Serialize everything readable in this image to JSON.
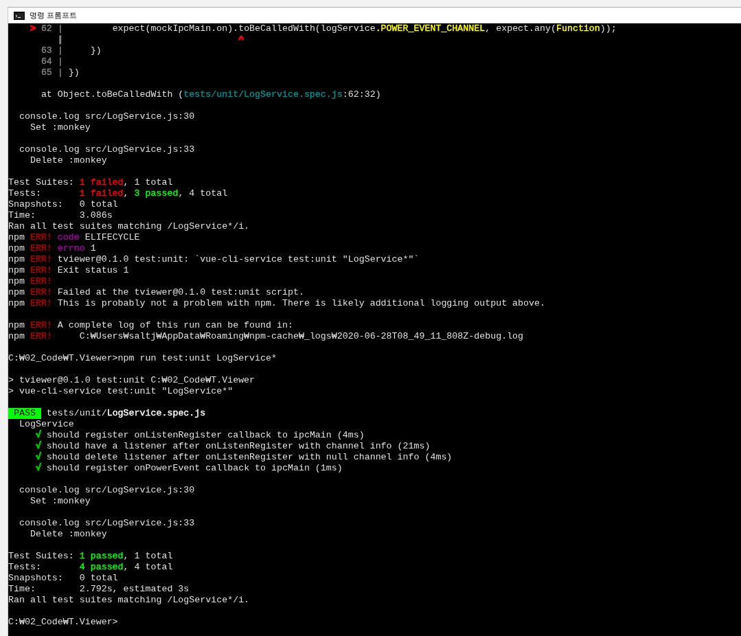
{
  "window": {
    "title": "명령 프롬프트"
  },
  "lines": [
    {
      "kind": "text",
      "segments": [
        {
          "text": "    >",
          "color": "#ff0000"
        },
        {
          "text": " 62 |",
          "color": "#808080"
        },
        {
          "text": "         expect(mockIpcMain.on).toBeCalledWith(logService"
        },
        {
          "text": ".POWER_EVENT_CHANNEL",
          "color": "#ffff00"
        },
        {
          "text": ", expect.any("
        },
        {
          "text": "Function",
          "color": "#ffff00"
        },
        {
          "text": "));"
        }
      ]
    },
    {
      "kind": "text",
      "segments": [
        {
          "text": "         |",
          "color": "#808080"
        },
        {
          "text": "                                ^",
          "color": "#ff0000"
        }
      ]
    },
    {
      "kind": "text",
      "segments": [
        {
          "text": "      63 |",
          "color": "#808080"
        },
        {
          "text": "     })"
        }
      ]
    },
    {
      "kind": "text",
      "segments": [
        {
          "text": "      64 |",
          "color": "#808080"
        }
      ]
    },
    {
      "kind": "text",
      "segments": [
        {
          "text": "      65 |",
          "color": "#808080"
        },
        {
          "text": " })"
        }
      ]
    },
    {
      "kind": "blank"
    },
    {
      "kind": "text",
      "segments": [
        {
          "text": "      at Object.toBeCalledWith ("
        },
        {
          "text": "tests/unit/LogService.spec.js",
          "color": "#008b8b"
        },
        {
          "text": ":62:32)"
        }
      ]
    },
    {
      "kind": "blank"
    },
    {
      "kind": "text",
      "segments": [
        {
          "text": "  console.log src/LogService.js:30"
        }
      ]
    },
    {
      "kind": "text",
      "segments": [
        {
          "text": "    Set :monkey"
        }
      ]
    },
    {
      "kind": "blank"
    },
    {
      "kind": "text",
      "segments": [
        {
          "text": "  console.log src/LogService.js:33"
        }
      ]
    },
    {
      "kind": "text",
      "segments": [
        {
          "text": "    Delete :monkey"
        }
      ]
    },
    {
      "kind": "blank"
    },
    {
      "kind": "text",
      "segments": [
        {
          "text": "Test Suites: "
        },
        {
          "text": "1 failed",
          "color": "#ff0000"
        },
        {
          "text": ", 1 total"
        }
      ]
    },
    {
      "kind": "text",
      "segments": [
        {
          "text": "Tests:       "
        },
        {
          "text": "1 failed",
          "color": "#ff0000"
        },
        {
          "text": ", "
        },
        {
          "text": "3 passed",
          "color": "#00ff00"
        },
        {
          "text": ", 4 total"
        }
      ]
    },
    {
      "kind": "text",
      "segments": [
        {
          "text": "Snapshots:   0 total"
        }
      ]
    },
    {
      "kind": "text",
      "segments": [
        {
          "text": "Time:        3.086s"
        }
      ]
    },
    {
      "kind": "text",
      "segments": [
        {
          "text": "Ran all test suites matching /LogService*/i."
        }
      ]
    },
    {
      "kind": "text",
      "segments": [
        {
          "text": "npm "
        },
        {
          "text": "ERR!",
          "color": "#b00000"
        },
        {
          "text": " code",
          "color": "#a000a0"
        },
        {
          "text": " ELIFECYCLE"
        }
      ]
    },
    {
      "kind": "text",
      "segments": [
        {
          "text": "npm "
        },
        {
          "text": "ERR!",
          "color": "#b00000"
        },
        {
          "text": " errno",
          "color": "#a000a0"
        },
        {
          "text": " 1"
        }
      ]
    },
    {
      "kind": "text",
      "segments": [
        {
          "text": "npm "
        },
        {
          "text": "ERR!",
          "color": "#b00000"
        },
        {
          "text": " tviewer@0.1.0 test:unit: `vue-cli-service test:unit \"LogService*\"`"
        }
      ]
    },
    {
      "kind": "text",
      "segments": [
        {
          "text": "npm "
        },
        {
          "text": "ERR!",
          "color": "#b00000"
        },
        {
          "text": " Exit status 1"
        }
      ]
    },
    {
      "kind": "text",
      "segments": [
        {
          "text": "npm "
        },
        {
          "text": "ERR!",
          "color": "#b00000"
        }
      ]
    },
    {
      "kind": "text",
      "segments": [
        {
          "text": "npm "
        },
        {
          "text": "ERR!",
          "color": "#b00000"
        },
        {
          "text": " Failed at the tviewer@0.1.0 test:unit script."
        }
      ]
    },
    {
      "kind": "text",
      "segments": [
        {
          "text": "npm "
        },
        {
          "text": "ERR!",
          "color": "#b00000"
        },
        {
          "text": " This is probably not a problem with npm. There is likely additional logging output above."
        }
      ]
    },
    {
      "kind": "blank"
    },
    {
      "kind": "text",
      "segments": [
        {
          "text": "npm "
        },
        {
          "text": "ERR!",
          "color": "#b00000"
        },
        {
          "text": " A complete log of this run can be found in:"
        }
      ]
    },
    {
      "kind": "text",
      "segments": [
        {
          "text": "npm "
        },
        {
          "text": "ERR!",
          "color": "#b00000"
        },
        {
          "text": "     C:₩Users₩saltj₩AppData₩Roaming₩npm-cache₩_logs₩2020-06-28T08_49_11_808Z-debug.log"
        }
      ]
    },
    {
      "kind": "blank"
    },
    {
      "kind": "text",
      "segments": [
        {
          "text": "C:₩02_Code₩T.Viewer>npm run test:unit LogService*"
        }
      ]
    },
    {
      "kind": "blank"
    },
    {
      "kind": "text",
      "segments": [
        {
          "text": "> tviewer@0.1.0 test:unit C:₩02_Code₩T.Viewer"
        }
      ]
    },
    {
      "kind": "text",
      "segments": [
        {
          "text": "> vue-cli-service test:unit \"LogService*\""
        }
      ]
    },
    {
      "kind": "blank"
    },
    {
      "kind": "text",
      "segments": [
        {
          "text": " PASS ",
          "color": "#00ff00",
          "kind": "badge"
        },
        {
          "text": " tests/unit/"
        },
        {
          "text": "LogService.spec.js",
          "color": "#ffffff"
        }
      ]
    },
    {
      "kind": "text",
      "segments": [
        {
          "text": "  LogService"
        }
      ]
    },
    {
      "kind": "text",
      "segments": [
        {
          "text": "     √",
          "color": "#00c000"
        },
        {
          "text": " should register onListenRegister callback to ipcMain (4ms)"
        }
      ]
    },
    {
      "kind": "text",
      "segments": [
        {
          "text": "     √",
          "color": "#00c000"
        },
        {
          "text": " should have a listener after onListenRegister with channel info (21ms)"
        }
      ]
    },
    {
      "kind": "text",
      "segments": [
        {
          "text": "     √",
          "color": "#00c000"
        },
        {
          "text": " should delete listener after onListenRegister with null channel info (4ms)"
        }
      ]
    },
    {
      "kind": "text",
      "segments": [
        {
          "text": "     √",
          "color": "#00c000"
        },
        {
          "text": " should register onPowerEvent callback to ipcMain (1ms)"
        }
      ]
    },
    {
      "kind": "blank"
    },
    {
      "kind": "text",
      "segments": [
        {
          "text": "  console.log src/LogService.js:30"
        }
      ]
    },
    {
      "kind": "text",
      "segments": [
        {
          "text": "    Set :monkey"
        }
      ]
    },
    {
      "kind": "blank"
    },
    {
      "kind": "text",
      "segments": [
        {
          "text": "  console.log src/LogService.js:33"
        }
      ]
    },
    {
      "kind": "text",
      "segments": [
        {
          "text": "    Delete :monkey"
        }
      ]
    },
    {
      "kind": "blank"
    },
    {
      "kind": "text",
      "segments": [
        {
          "text": "Test Suites: "
        },
        {
          "text": "1 passed",
          "color": "#00ff00"
        },
        {
          "text": ", 1 total"
        }
      ]
    },
    {
      "kind": "text",
      "segments": [
        {
          "text": "Tests:       "
        },
        {
          "text": "4 passed",
          "color": "#00ff00"
        },
        {
          "text": ", 4 total"
        }
      ]
    },
    {
      "kind": "text",
      "segments": [
        {
          "text": "Snapshots:   0 total"
        }
      ]
    },
    {
      "kind": "text",
      "segments": [
        {
          "text": "Time:        2.792s, estimated 3s"
        }
      ]
    },
    {
      "kind": "text",
      "segments": [
        {
          "text": "Ran all test suites matching /LogService*/i."
        }
      ]
    },
    {
      "kind": "blank"
    },
    {
      "kind": "text",
      "segments": [
        {
          "text": "C:₩02_Code₩T.Viewer>"
        }
      ]
    }
  ]
}
